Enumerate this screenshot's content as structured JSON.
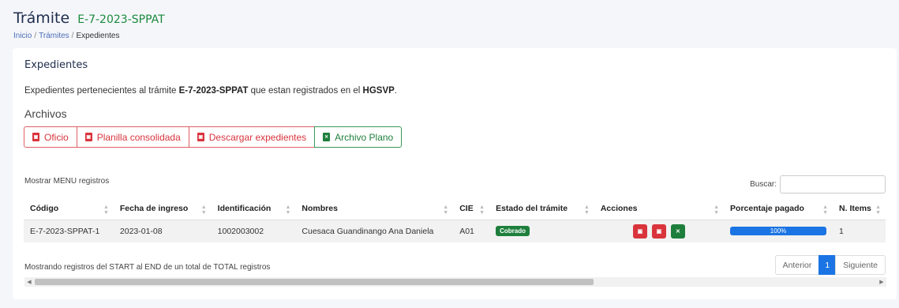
{
  "header": {
    "title": "Trámite",
    "code": "E-7-2023-SPPAT",
    "breadcrumb": [
      "Inicio",
      "Trámites",
      "Expedientes"
    ],
    "breadcrumb_sep": "/"
  },
  "card": {
    "title": "Expedientes",
    "description_pre": "Expedientes pertenecientes al trámite ",
    "description_code": "E-7-2023-SPPAT",
    "description_mid": " que estan registrados en el ",
    "description_place": "HGSVP",
    "description_post": ".",
    "archivos_label": "Archivos",
    "buttons": [
      {
        "label": "Oficio",
        "icon": "pdf-icon",
        "color": "#d9343c"
      },
      {
        "label": "Planilla consolidada",
        "icon": "pdf-icon",
        "color": "#d9343c"
      },
      {
        "label": "Descargar expedientes",
        "icon": "pdf-icon",
        "color": "#d9343c"
      },
      {
        "label": "Archivo Plano",
        "icon": "excel-icon",
        "color": "#1e7f3c"
      }
    ]
  },
  "table_controls": {
    "length_label": "Mostrar MENU registros",
    "search_label": "Buscar:",
    "search_value": ""
  },
  "table": {
    "columns": [
      "Código",
      "Fecha de ingreso",
      "Identificación",
      "Nombres",
      "CIE",
      "Estado del trámite",
      "Acciones",
      "Porcentaje pagado",
      "N. Items"
    ],
    "rows": [
      {
        "codigo": "E-7-2023-SPPAT-1",
        "fecha": "2023-01-08",
        "identificacion": "1002003002",
        "nombres": "Cuesaca Guandinango Ana Daniela",
        "cie": "A01",
        "estado": "Cobrado",
        "porcentaje": "100%",
        "porcentaje_value": 100,
        "items": "1"
      }
    ]
  },
  "footer": {
    "info": "Mostrando registros del START al END de un total de TOTAL registros",
    "prev": "Anterior",
    "page": "1",
    "next": "Siguiente"
  },
  "colors": {
    "primary": "#1b74e4",
    "danger": "#d9343c",
    "success": "#1e7f3c",
    "title": "#1f2d4d"
  }
}
